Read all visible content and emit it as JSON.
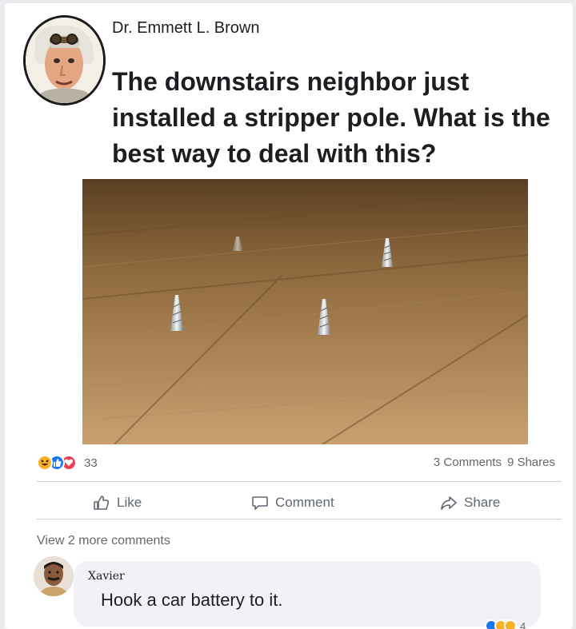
{
  "post": {
    "author": "Dr. Emmett L. Brown",
    "text": "The downstairs neighbor just installed a stripper pole. What is the best way to deal with this?",
    "image_subject": "screws-poking-through-wooden-floor"
  },
  "reactions": {
    "types": [
      "haha",
      "like",
      "love"
    ],
    "count": "33",
    "comments": "3 Comments",
    "shares": "9 Shares"
  },
  "actions": {
    "like": "Like",
    "comment": "Comment",
    "share": "Share"
  },
  "comments_section": {
    "view_more": "View 2 more comments",
    "comment": {
      "name": "Xavier",
      "text": "Hook a car battery to it.",
      "reaction_count": "4"
    }
  },
  "colors": {
    "like_blue": "#1877f2",
    "love_red": "#f33e58",
    "haha_yellow": "#f7b125",
    "text_primary": "#1c1e21",
    "text_secondary": "#65676b"
  }
}
